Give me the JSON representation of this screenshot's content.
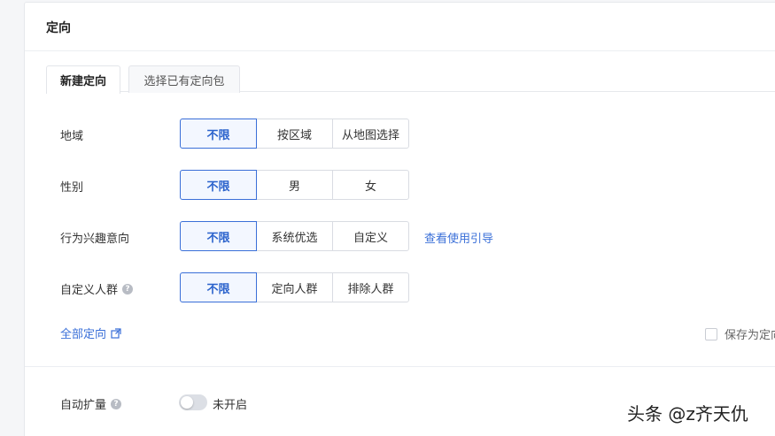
{
  "card": {
    "title": "定向"
  },
  "tabs": [
    {
      "label": "新建定向",
      "active": true
    },
    {
      "label": "选择已有定向包",
      "active": false
    }
  ],
  "rows": [
    {
      "label": "地域",
      "options": [
        "不限",
        "按区域",
        "从地图选择"
      ],
      "selected": 0
    },
    {
      "label": "性别",
      "options": [
        "不限",
        "男",
        "女"
      ],
      "selected": 0
    },
    {
      "label": "行为兴趣意向",
      "options": [
        "不限",
        "系统优选",
        "自定义"
      ],
      "selected": 0,
      "link": "查看使用引导"
    },
    {
      "label": "自定义人群",
      "options": [
        "不限",
        "定向人群",
        "排除人群"
      ],
      "selected": 0,
      "help": true
    }
  ],
  "all_targeting_link": "全部定向",
  "save_checkbox_label": "保存为定向",
  "auto_expand": {
    "label": "自动扩量",
    "status": "未开启",
    "enabled": false
  },
  "watermark": "头条 @z齐天仇",
  "colors": {
    "accent": "#3a6fd8",
    "selected_bg": "#f3f7ff",
    "border": "#d9dce2"
  },
  "icons": {
    "help": "question-circle-icon",
    "external": "external-link-icon"
  }
}
